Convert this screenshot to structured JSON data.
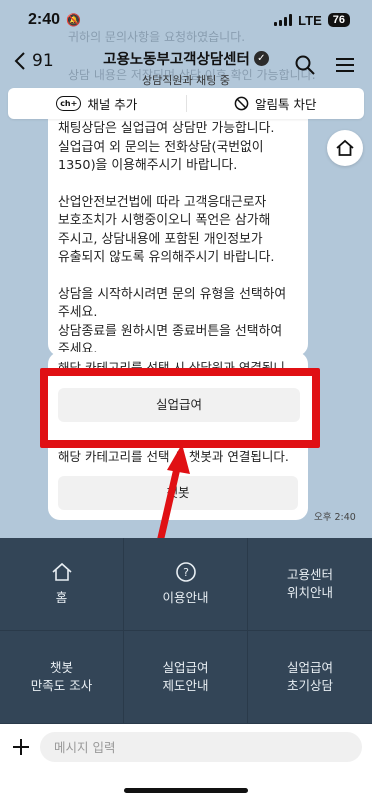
{
  "status_bar": {
    "time": "2:40",
    "network": "LTE",
    "battery": "76"
  },
  "background_text": [
    "귀하의 문의사항을 요청하였습니다.",
    "상담 내용은 저장되며 상담 이후 확인 가능합니다."
  ],
  "header": {
    "back_count": "91",
    "title": "고용노동부고객상담센터",
    "subtitle": "상담직원과 채팅 중"
  },
  "channel_bar": {
    "add_badge": "ch+",
    "add_label": "채널 추가",
    "block_label": "알림톡 차단"
  },
  "message": {
    "paragraphs": [
      "채팅상담은 실업급여 상담만 가능합니다. 실업급여 외 문의는 전화상담(국번없이 1350)을 이용해주시기 바랍니다.",
      "산업안전보건법에 따라 고객응대근로자 보호조치가 시행중이오니 폭언은 삼가해 주시고, 상담내용에 포함된 개인정보가 유출되지 않도록 유의해주시기 바랍니다.",
      "상담을 시작하시려면 문의 유형을 선택하여 주세요.\n상담종료를 원하시면 종료버튼을 선택하여 주세요."
    ]
  },
  "card": {
    "text1": "해당 카테고리를 선택 시 상담원과 연결됩니다.",
    "button1": "실업급여",
    "text2": "해당 카테고리를 선택 시 챗봇과 연결됩니다.",
    "button2": "챗봇",
    "time": "오후 2:40"
  },
  "menu": [
    {
      "label": "홈",
      "icon": "home-icon"
    },
    {
      "label": "이용안내",
      "icon": "help-icon"
    },
    {
      "label": "고용센터\n위치안내",
      "icon": ""
    },
    {
      "label": "챗봇\n만족도 조사",
      "icon": ""
    },
    {
      "label": "실업급여\n제도안내",
      "icon": ""
    },
    {
      "label": "실업급여\n초기상담",
      "icon": ""
    }
  ],
  "input": {
    "placeholder": "메시지 입력"
  },
  "colors": {
    "highlight": "#e01014",
    "menu_bg": "#334557",
    "chat_bg": "#b2c7d9"
  }
}
